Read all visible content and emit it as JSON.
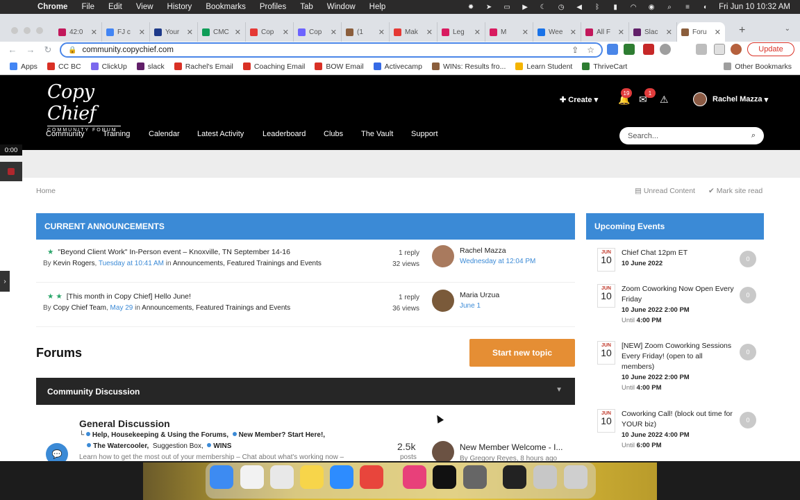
{
  "menubar": {
    "app": "Chrome",
    "items": [
      "File",
      "Edit",
      "View",
      "History",
      "Bookmarks",
      "Profiles",
      "Tab",
      "Window",
      "Help"
    ],
    "clock": "Fri Jun 10  10:32 AM"
  },
  "tabs": [
    {
      "label": "42:0",
      "color": "#c2185b"
    },
    {
      "label": "FJ c",
      "color": "#4285f4"
    },
    {
      "label": "Your",
      "color": "#1e3a8a"
    },
    {
      "label": "CMC",
      "color": "#0f9d58"
    },
    {
      "label": "Cop",
      "color": "#e53935"
    },
    {
      "label": "Cop",
      "color": "#6c63ff"
    },
    {
      "label": "(1",
      "color": "#8b5e3c"
    },
    {
      "label": "Mak",
      "color": "#e53935"
    },
    {
      "label": "Leg",
      "color": "#d81b60"
    },
    {
      "label": "M",
      "color": "#d81b60"
    },
    {
      "label": "Wee",
      "color": "#1a73e8"
    },
    {
      "label": "All F",
      "color": "#c2185b"
    },
    {
      "label": "Slac",
      "color": "#611f69"
    },
    {
      "label": "Foru",
      "color": "#8b5e3c"
    }
  ],
  "address": {
    "url": "community.copychief.com",
    "update_label": "Update"
  },
  "bookmarks": [
    {
      "label": "Apps",
      "color": "#4285f4"
    },
    {
      "label": "CC BC",
      "color": "#d93025"
    },
    {
      "label": "ClickUp",
      "color": "#7b68ee"
    },
    {
      "label": "slack",
      "color": "#611f69"
    },
    {
      "label": "Rachel's Email",
      "color": "#d93025"
    },
    {
      "label": "Coaching Email",
      "color": "#d93025"
    },
    {
      "label": "BOW Email",
      "color": "#d93025"
    },
    {
      "label": "Activecamp",
      "color": "#356ae6"
    },
    {
      "label": "WINs: Results fro...",
      "color": "#8b5e3c"
    },
    {
      "label": "Learn Student",
      "color": "#f4b400"
    },
    {
      "label": "ThriveCart",
      "color": "#2e7d32"
    }
  ],
  "bookmarks_other": "Other Bookmarks",
  "site": {
    "logo_main": "Copy Chief",
    "logo_sub": "COMMUNITY FORUM",
    "create_label": "Create",
    "notif_count": "19",
    "msg_count": "1",
    "username": "Rachel Mazza",
    "nav": [
      "Community",
      "Training",
      "Calendar",
      "Latest Activity",
      "Leaderboard",
      "Clubs",
      "The Vault",
      "Support"
    ],
    "search_placeholder": "Search...",
    "breadcrumb": "Home",
    "unread_label": "Unread Content",
    "markread_label": "Mark site read"
  },
  "announcements": {
    "title": "CURRENT ANNOUNCEMENTS",
    "items": [
      {
        "stars": "★",
        "title": "\"Beyond Client Work\" In-Person event – Knoxville, TN September 14-16",
        "by": "By",
        "author": "Kevin Rogers",
        "date": "Tuesday at 10:41 AM",
        "in": "in",
        "cats": "Announcements, Featured Trainings and Events",
        "replies": "1 reply",
        "views": "32 views",
        "last_user": "Rachel Mazza",
        "last_date": "Wednesday at 12:04 PM"
      },
      {
        "stars": "★  ★",
        "title": "[This month in Copy Chief] Hello June!",
        "by": "By",
        "author": "Copy Chief Team",
        "date": "May 29",
        "in": "in",
        "cats": "Announcements, Featured Trainings and Events",
        "replies": "1 reply",
        "views": "36 views",
        "last_user": "Maria Urzua",
        "last_date": "June 1"
      }
    ]
  },
  "forums": {
    "title": "Forums",
    "start_label": "Start new topic",
    "category": "Community Discussion",
    "forum": {
      "name": "General Discussion",
      "sub1": "Help, Housekeeping & Using the Forums,",
      "sub2": "New Member? Start Here!,",
      "sub3": "The Watercooler,",
      "sub4": "Suggestion Box,",
      "sub5": "WINS",
      "desc": "Learn how to get the most out of your membership – Chat about what's working now –",
      "count": "2.5k",
      "count_label": "posts",
      "last_topic": "New Member Welcome - I...",
      "last_by": "By Gregory Reyes, 8 hours ago"
    }
  },
  "events": {
    "title": "Upcoming Events",
    "items": [
      {
        "mo": "JUN",
        "dy": "10",
        "title": "Chief Chat 12pm ET",
        "when": "10 June 2022",
        "until_label": "",
        "until": "",
        "count": "0"
      },
      {
        "mo": "JUN",
        "dy": "10",
        "title": "Zoom Coworking Now Open Every Friday",
        "when": "10 June 2022 2:00 PM",
        "until_label": "Until",
        "until": "4:00 PM",
        "count": "0"
      },
      {
        "mo": "JUN",
        "dy": "10",
        "title": "[NEW] Zoom Coworking Sessions Every Friday! (open to all members)",
        "when": "10 June 2022 2:00 PM",
        "until_label": "Until",
        "until": "4:00 PM",
        "count": "0"
      },
      {
        "mo": "JUN",
        "dy": "10",
        "title": "Coworking Call! (block out time for YOUR biz)",
        "when": "10 June 2022 4:00 PM",
        "until_label": "Until",
        "until": "6:00 PM",
        "count": "0"
      }
    ]
  },
  "overlay": {
    "rec_time": "0:00"
  },
  "dock": [
    {
      "name": "Finder",
      "color": "#3d8bf2"
    },
    {
      "name": "Reminders",
      "color": "#f2f2f2"
    },
    {
      "name": "Launchpad",
      "color": "#e8e8e8"
    },
    {
      "name": "Notes",
      "color": "#f7d54a"
    },
    {
      "name": "Zoom",
      "color": "#2d8cff"
    },
    {
      "name": "Chrome",
      "color": "#e8453c"
    },
    {
      "name": "CleanMyMac",
      "color": "#e8407a"
    },
    {
      "name": "Apple TV",
      "color": "#111111"
    },
    {
      "name": "Keychain",
      "color": "#666666"
    },
    {
      "name": "Screen 1",
      "color": "#222222"
    },
    {
      "name": "Screen 2",
      "color": "#c7c7c7"
    },
    {
      "name": "Trash",
      "color": "#cfcfcf"
    }
  ]
}
